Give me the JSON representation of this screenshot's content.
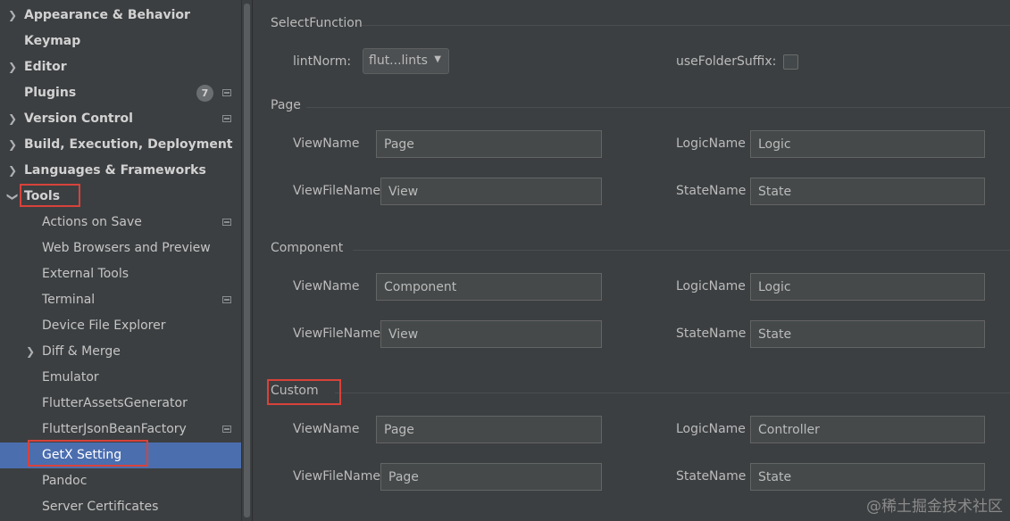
{
  "sidebar": {
    "items": [
      {
        "label": "Appearance & Behavior",
        "level": 0,
        "chevron": "right"
      },
      {
        "label": "Keymap",
        "level": 0,
        "chevron": ""
      },
      {
        "label": "Editor",
        "level": 0,
        "chevron": "right"
      },
      {
        "label": "Plugins",
        "level": 0,
        "chevron": "",
        "badge": "7"
      },
      {
        "label": "Version Control",
        "level": 0,
        "chevron": "right"
      },
      {
        "label": "Build, Execution, Deployment",
        "level": 0,
        "chevron": "right"
      },
      {
        "label": "Languages & Frameworks",
        "level": 0,
        "chevron": "right"
      },
      {
        "label": "Tools",
        "level": 0,
        "chevron": "down"
      },
      {
        "label": "Actions on Save",
        "level": 1
      },
      {
        "label": "Web Browsers and Preview",
        "level": 1
      },
      {
        "label": "External Tools",
        "level": 1
      },
      {
        "label": "Terminal",
        "level": 1
      },
      {
        "label": "Device File Explorer",
        "level": 1
      },
      {
        "label": "Diff & Merge",
        "level": 1,
        "chevron": "right"
      },
      {
        "label": "Emulator",
        "level": 1
      },
      {
        "label": "FlutterAssetsGenerator",
        "level": 1
      },
      {
        "label": "FlutterJsonBeanFactory",
        "level": 1
      },
      {
        "label": "GetX Setting",
        "level": 1,
        "selected": true
      },
      {
        "label": "Pandoc",
        "level": 1
      },
      {
        "label": "Server Certificates",
        "level": 1
      }
    ]
  },
  "icons": {
    "chevron_right": "chevron-right-icon",
    "chevron_down": "chevron-down-icon",
    "project": "project-level-icon",
    "dropdown_arrow": "dropdown-arrow-icon"
  },
  "colors": {
    "background": "#3c3f41",
    "selection": "#4b6eaf",
    "highlight_box": "#d8423b",
    "input_bg": "#45494a"
  },
  "main": {
    "select_function": {
      "title": "SelectFunction",
      "lint_norm_label": "lintNorm:",
      "lint_norm_value": "flut...lints",
      "use_folder_suffix_label": "useFolderSuffix:",
      "use_folder_suffix_checked": false
    },
    "page": {
      "title": "Page",
      "view_name_label": "ViewName",
      "view_name_value": "Page",
      "logic_name_label": "LogicName",
      "logic_name_value": "Logic",
      "view_file_name_label": "ViewFileName",
      "view_file_name_value": "View",
      "state_name_label": "StateName",
      "state_name_value": "State"
    },
    "component": {
      "title": "Component",
      "view_name_label": "ViewName",
      "view_name_value": "Component",
      "logic_name_label": "LogicName",
      "logic_name_value": "Logic",
      "view_file_name_label": "ViewFileName",
      "view_file_name_value": "View",
      "state_name_label": "StateName",
      "state_name_value": "State"
    },
    "custom": {
      "title": "Custom",
      "view_name_label": "ViewName",
      "view_name_value": "Page",
      "logic_name_label": "LogicName",
      "logic_name_value": "Controller",
      "view_file_name_label": "ViewFileName",
      "view_file_name_value": "Page",
      "state_name_label": "StateName",
      "state_name_value": "State"
    }
  },
  "watermark": "@稀土掘金技术社区"
}
